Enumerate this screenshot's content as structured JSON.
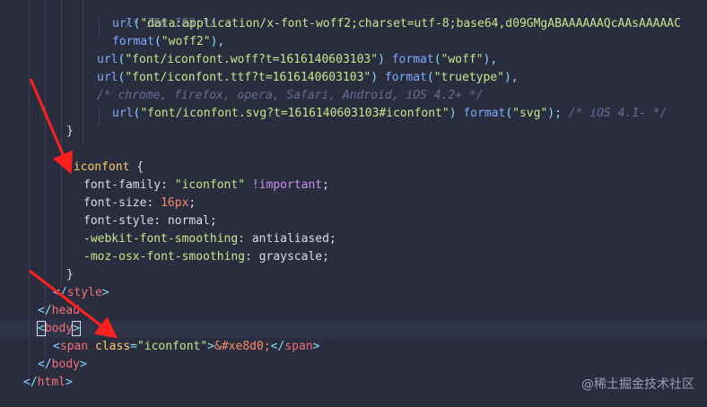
{
  "code": {
    "l1_comment": "/* IE6-IE8 */",
    "l2_fn": "url",
    "l2_open": "(",
    "l2_str": "\"data:application/x-font-woff2;charset=utf-8;base64,d09GMgABAAAAAAQcAAsAAAAAC",
    "l3_fn": "format",
    "l3_open": "(",
    "l3_str": "\"woff2\"",
    "l3_close": "),",
    "l4_fn": "url",
    "l4_open": "(",
    "l4_str": "\"font/iconfont.woff?t=1616140603103\"",
    "l4_close": ")",
    "l4_fn2": "format",
    "l4_open2": "(",
    "l4_str2": "\"woff\"",
    "l4_close2": "),",
    "l5_fn": "url",
    "l5_open": "(",
    "l5_str": "\"font/iconfont.ttf?t=1616140603103\"",
    "l5_close": ")",
    "l5_fn2": "format",
    "l5_open2": "(",
    "l5_str2": "\"truetype\"",
    "l5_close2": "),",
    "l6_comment": "/* chrome, firefox, opera, Safari, Android, iOS 4.2+ */",
    "l7_fn": "url",
    "l7_open": "(",
    "l7_str": "\"font/iconfont.svg?t=1616140603103#iconfont\"",
    "l7_close": ")",
    "l7_fn2": "format",
    "l7_open2": "(",
    "l7_str2": "\"svg\"",
    "l7_close2": ");",
    "l7_comment": "/* iOS 4.1- */",
    "l8_brace": "}",
    "l10_sel": ".iconfont",
    "l10_brace": "{",
    "l11_prop": "font-family:",
    "l11_val": "\"iconfont\"",
    "l11_bang": "!important",
    "l11_semi": ";",
    "l12_prop": "font-size:",
    "l12_num": "16px",
    "l12_semi": ";",
    "l13_prop": "font-style:",
    "l13_val": "normal",
    "l13_semi": ";",
    "l14_prop": "-webkit-font-smoothing:",
    "l14_val": "antialiased",
    "l14_semi": ";",
    "l15_prop": "-moz-osx-font-smoothing:",
    "l15_val": "grayscale",
    "l15_semi": ";",
    "l16_brace": "}",
    "l17_open": "</",
    "l17_tag": "style",
    "l17_close": ">",
    "l18_open": "</",
    "l18_tag": "head",
    "l19_lt": "<",
    "l19_tag": "body",
    "l19_gt": ">",
    "l20_open": "<",
    "l20_tag": "span",
    "l20_attr": "class",
    "l20_eq": "=",
    "l20_str": "\"iconfont\"",
    "l20_gt": ">",
    "l20_ent": "&#xe8d0;",
    "l20_close_open": "</",
    "l20_close_tag": "span",
    "l20_close_gt": ">",
    "l21_open": "</",
    "l21_tag": "body",
    "l21_close": ">",
    "l22_open": "</",
    "l22_tag": "html",
    "l22_close": ">"
  },
  "watermark": "@稀土掘金技术社区",
  "colors": {
    "background": "#292d3e",
    "arrow": "#ff1f1f"
  }
}
